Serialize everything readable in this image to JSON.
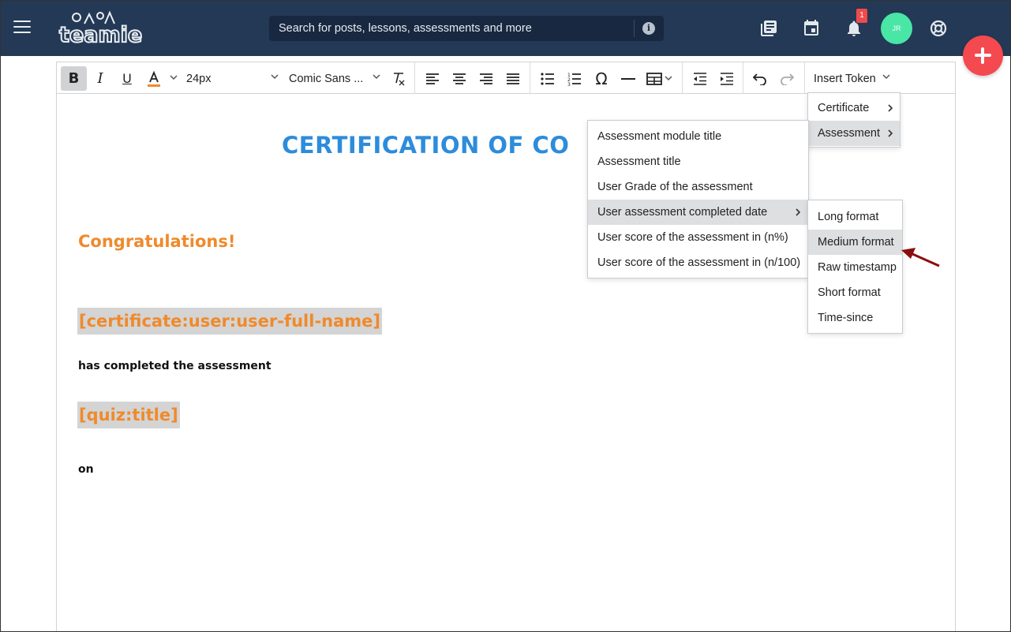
{
  "app": {
    "logo_text": "teamie"
  },
  "search": {
    "placeholder": "Search for posts, lessons, assessments and more"
  },
  "nav": {
    "icons": [
      "library-icon",
      "calendar-icon",
      "bell-icon",
      "help-icon"
    ],
    "notification_count": "1",
    "avatar_initials": "JR",
    "avatar_color": "#49e6a6"
  },
  "toolbar": {
    "font_size": "24px",
    "font_family": "Comic Sans ...",
    "insert_token_label": "Insert Token",
    "text_color": "#ef8a2c"
  },
  "document": {
    "title": "CERTIFICATION OF CO",
    "congrats": "Congratulations!",
    "token_user_name": "[certificate:user:user-full-name]",
    "completed_text": "has completed the assessment",
    "token_quiz_title": "[quiz:title]",
    "on_text": "on",
    "title_color": "#2d8cdb",
    "accent_color": "#ef8a2c"
  },
  "token_menu": {
    "items": [
      {
        "label": "Certificate",
        "has_submenu": true
      },
      {
        "label": "Assessment",
        "has_submenu": true,
        "highlighted": true
      }
    ]
  },
  "assessment_menu": {
    "items": [
      {
        "label": "Assessment module title"
      },
      {
        "label": "Assessment title"
      },
      {
        "label": "User Grade of the assessment"
      },
      {
        "label": "User assessment completed date",
        "has_submenu": true,
        "highlighted": true
      },
      {
        "label": "User score of the assessment in (n%)"
      },
      {
        "label": "User score of the assessment in (n/100)"
      }
    ]
  },
  "date_format_menu": {
    "items": [
      {
        "label": "Long format"
      },
      {
        "label": "Medium format",
        "highlighted": true
      },
      {
        "label": "Raw timestamp"
      },
      {
        "label": "Short format"
      },
      {
        "label": "Time-since"
      }
    ]
  },
  "annotation": {
    "arrow_color": "#8b0d0d"
  }
}
